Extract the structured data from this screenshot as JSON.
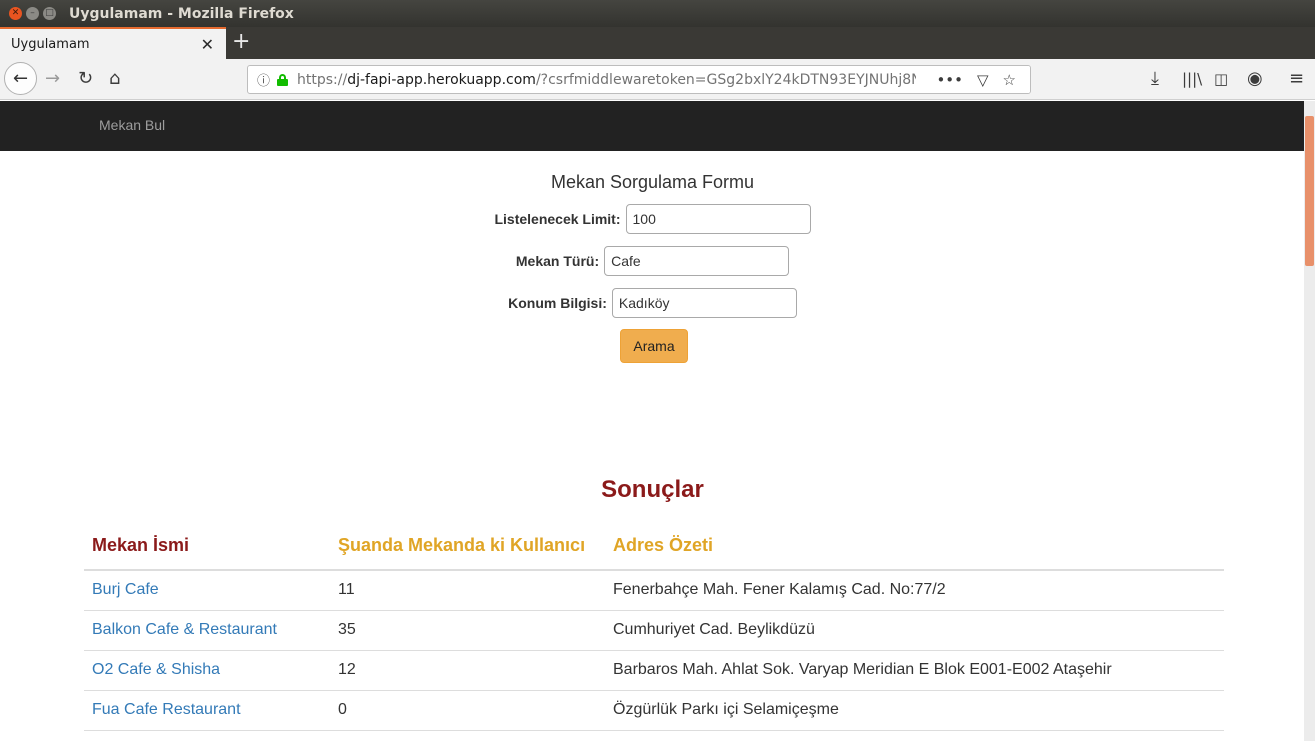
{
  "window": {
    "title": "Uygulamam - Mozilla Firefox"
  },
  "tab": {
    "title": "Uygulamam"
  },
  "urlbar": {
    "scheme": "https://",
    "host": "dj-fapi-app.herokuapp.com",
    "path": "/?csrfmiddlewaretoken=GSg2bxlY24kDTN93EYJNUhj8N"
  },
  "site": {
    "brand": "Mekan Bul"
  },
  "form": {
    "title": "Mekan Sorgulama Formu",
    "limit_label": "Listelenecek Limit:",
    "limit_value": "100",
    "type_label": "Mekan Türü:",
    "type_value": "Cafe",
    "location_label": "Konum Bilgisi:",
    "location_value": "Kadıköy",
    "search_button": "Arama"
  },
  "results": {
    "title": "Sonuçlar",
    "columns": [
      "Mekan İsmi",
      "Şuanda Mekanda ki Kullanıcı",
      "Adres Özeti"
    ],
    "rows": [
      {
        "name": "Burj Cafe",
        "users": "11",
        "address": "Fenerbahçe Mah. Fener Kalamış Cad. No:77/2"
      },
      {
        "name": "Balkon Cafe & Restaurant",
        "users": "35",
        "address": "Cumhuriyet Cad. Beylikdüzü"
      },
      {
        "name": "O2 Cafe & Shisha",
        "users": "12",
        "address": "Barbaros Mah. Ahlat Sok. Varyap Meridian E Blok E001-E002 Ataşehir"
      },
      {
        "name": "Fua Cafe Restaurant",
        "users": "0",
        "address": "Özgürlük Parkı içi Selamiçeşme"
      }
    ]
  },
  "colors": {
    "accent_tab": "#e66b30",
    "navbar_bg": "#222222",
    "results_title": "#8b1a1a",
    "column_header_alt": "#e0a526",
    "link": "#337ab7",
    "button": "#f0ad4e"
  }
}
